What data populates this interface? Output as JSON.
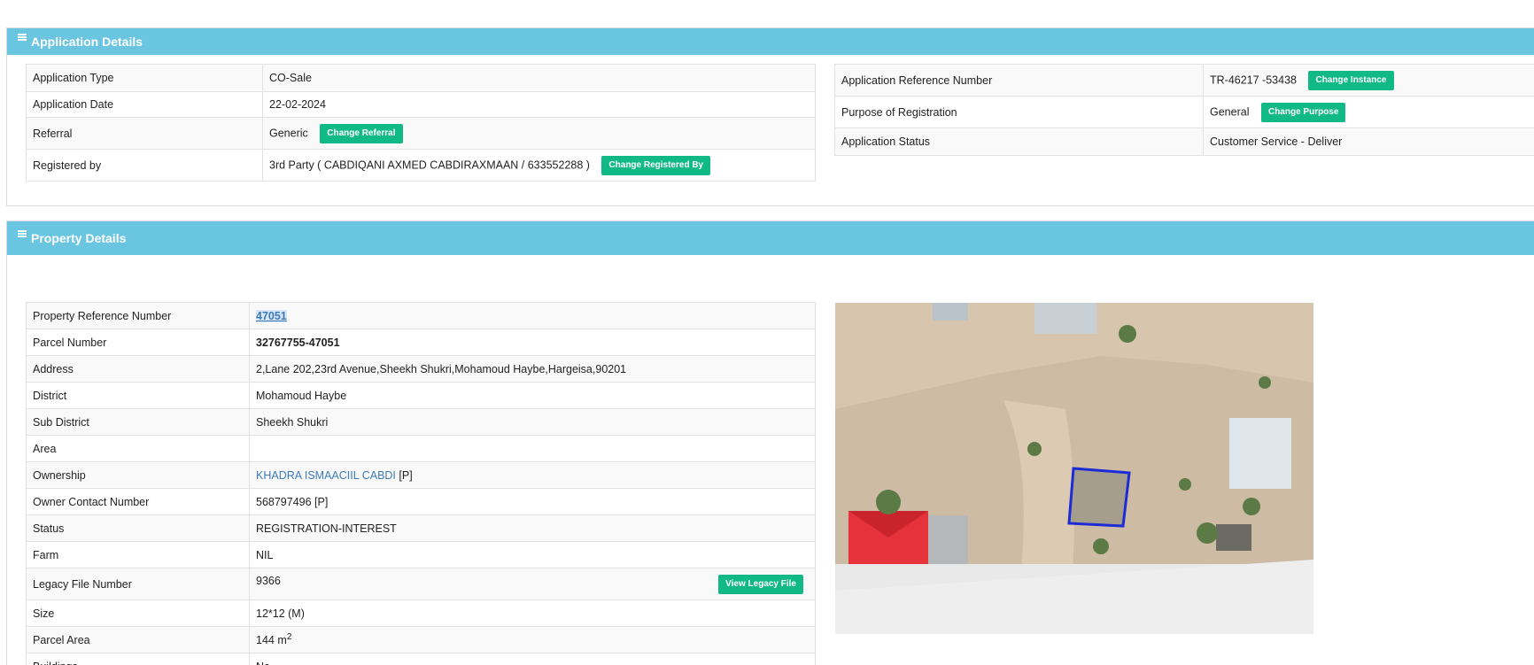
{
  "application_details": {
    "title": "Application Details",
    "left_rows": [
      {
        "label": "Application Type",
        "value": "CO-Sale"
      },
      {
        "label": "Application Date",
        "value": "22-02-2024"
      },
      {
        "label": "Referral",
        "value": "Generic",
        "button": "Change Referral"
      },
      {
        "label": "Registered by",
        "value": "3rd Party ( CABDIQANI AXMED CABDIRAXMAAN / 633552288 )",
        "button": "Change Registered By"
      }
    ],
    "right_rows": [
      {
        "label": "Application Reference Number",
        "value": "TR-46217 -53438",
        "button": "Change Instance"
      },
      {
        "label": "Purpose of Registration",
        "value": "General",
        "button": "Change Purpose"
      },
      {
        "label": "Application Status",
        "value": "Customer Service - Deliver"
      }
    ]
  },
  "property_details": {
    "title": "Property Details",
    "rows": [
      {
        "label": "Property Reference Number",
        "value": "47051"
      },
      {
        "label": "Parcel Number",
        "value": "32767755-47051"
      },
      {
        "label": "Address",
        "value": "2,Lane 202,23rd Avenue,Sheekh Shukri,Mohamoud Haybe,Hargeisa,90201"
      },
      {
        "label": "District",
        "value": "Mohamoud Haybe"
      },
      {
        "label": "Sub District",
        "value": "Sheekh Shukri"
      },
      {
        "label": "Area",
        "value": ""
      },
      {
        "label": "Ownership",
        "value": "KHADRA ISMAACIIL CABDI",
        "suffix": " [P]"
      },
      {
        "label": "Owner Contact Number",
        "value": "568797496 [P]"
      },
      {
        "label": "Status",
        "value": "REGISTRATION-INTEREST"
      },
      {
        "label": "Farm",
        "value": "NIL"
      },
      {
        "label": "Legacy File Number",
        "value": "9366",
        "button": "View Legacy File"
      },
      {
        "label": "Size",
        "value": "12*12 (M)"
      },
      {
        "label": "Parcel Area",
        "value": "144 m",
        "sup": "2"
      },
      {
        "label": "Buildings",
        "value": "No"
      }
    ]
  },
  "colors": {
    "header": "#6ac5e0",
    "button": "#11b986",
    "link": "#3c7ab7",
    "parcel_outline": "#1b2bd6",
    "roof_red": "#e5323b"
  }
}
